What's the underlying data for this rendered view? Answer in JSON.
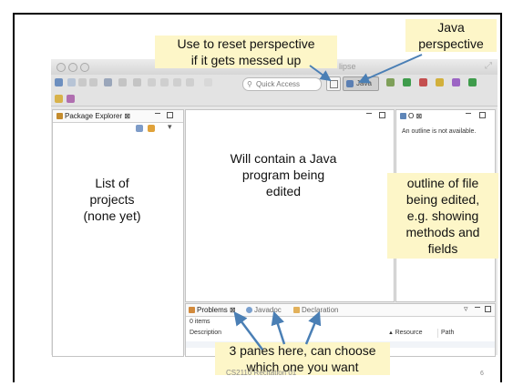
{
  "window": {
    "title": "lipse",
    "quick_access_placeholder": "Quick Access",
    "java_perspective_label": "Java"
  },
  "package_explorer": {
    "tab_label": "Package Explorer",
    "close_glyph": "⊠"
  },
  "outline": {
    "tab_label": "O",
    "close_glyph": "⊠",
    "message": "An outline is not available."
  },
  "bottom_panel": {
    "tabs": [
      {
        "label": "Problems",
        "active": true
      },
      {
        "label": "Javadoc",
        "active": false
      },
      {
        "label": "Declaration",
        "active": false
      }
    ],
    "close_glyph": "⊠",
    "item_count": "0 items",
    "columns": [
      "Description",
      "Resource",
      "Path"
    ]
  },
  "annotations": {
    "reset_perspective": [
      "Use to reset perspective",
      "if it gets messed up"
    ],
    "java_perspective": [
      "Java",
      "perspective"
    ],
    "editor": [
      "Will contain a Java",
      "program being",
      "edited"
    ],
    "projects": [
      "List of",
      "projects",
      "(none yet)"
    ],
    "outline": [
      "outline of file",
      "being edited,",
      "e.g. showing",
      "methods and",
      "fields"
    ],
    "panes": [
      "3 panes here, can choose",
      "which one you want"
    ]
  },
  "footer": {
    "text": "CS2110 Recitation 01",
    "page_number": "6"
  },
  "colors": {
    "annotation_bg": "#fdf6c8",
    "arrow": "#4a7fb5"
  }
}
